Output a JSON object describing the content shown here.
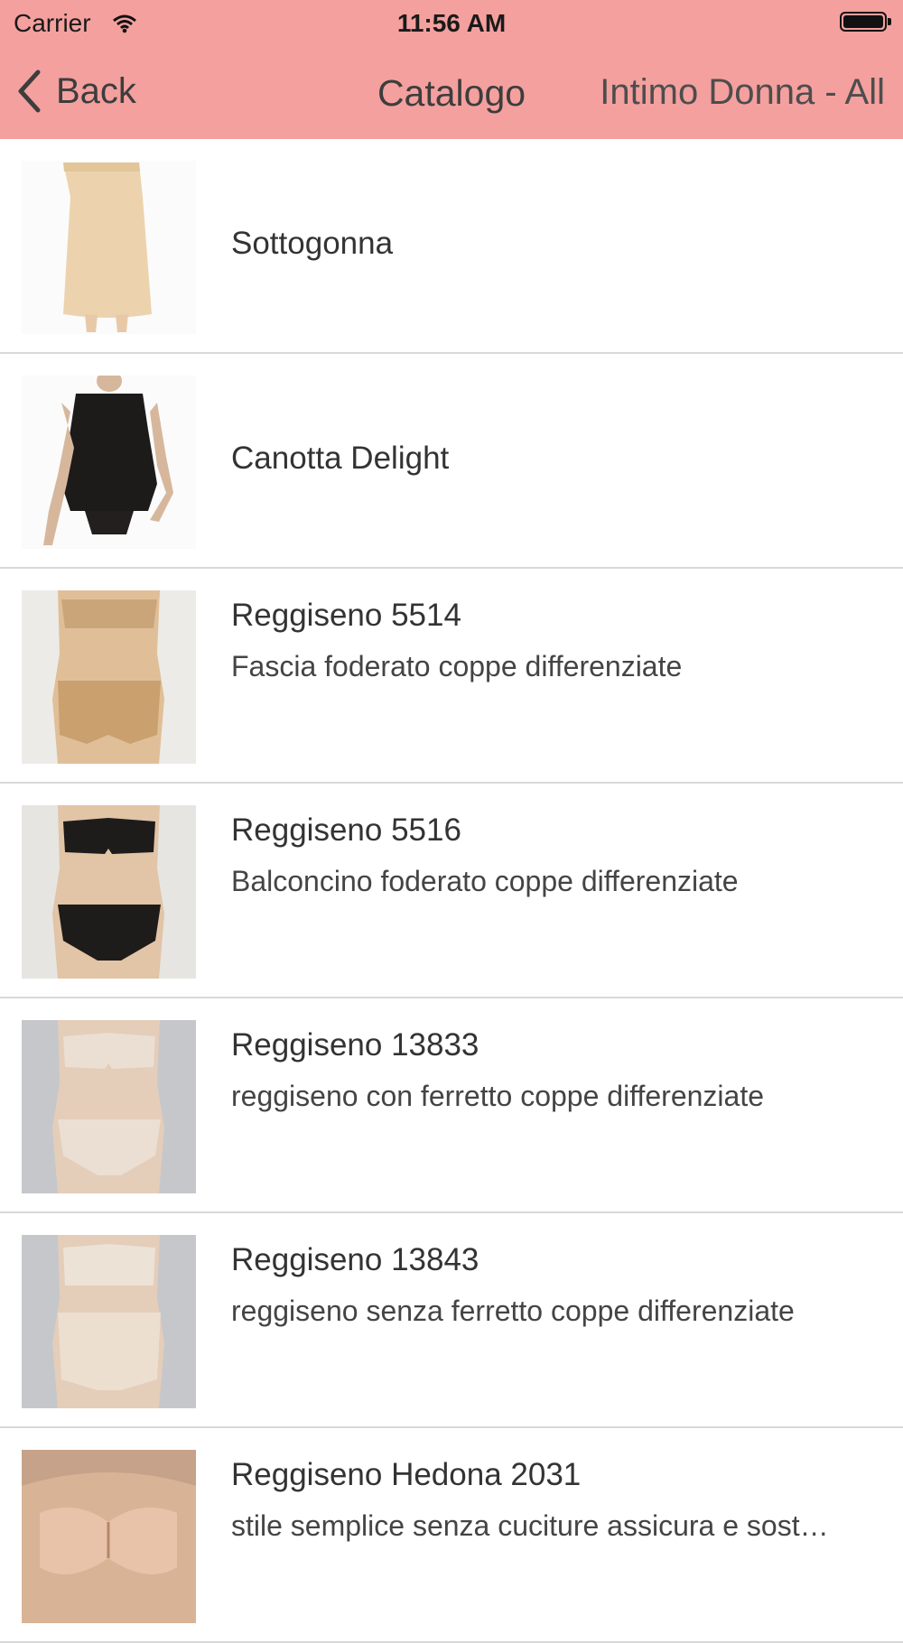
{
  "status_bar": {
    "carrier": "Carrier",
    "time": "11:56 AM",
    "icons": [
      "wifi-icon",
      "battery-icon"
    ]
  },
  "nav": {
    "back_label": "Back",
    "title": "Catalogo",
    "right_label": "Intimo Donna - All",
    "background_color": "#f4a09e"
  },
  "products": [
    {
      "name": "Sottogonna",
      "description": ""
    },
    {
      "name": "Canotta Delight",
      "description": ""
    },
    {
      "name": "Reggiseno 5514",
      "description": "Fascia foderato coppe differenziate"
    },
    {
      "name": "Reggiseno 5516",
      "description": "Balconcino foderato coppe differenziate"
    },
    {
      "name": "Reggiseno 13833",
      "description": "reggiseno con ferretto coppe differenziate"
    },
    {
      "name": "Reggiseno 13843",
      "description": "reggiseno senza ferretto coppe differenziate"
    },
    {
      "name": "Reggiseno Hedona 2031",
      "description": "stile semplice senza cuciture assicura e sost…"
    }
  ]
}
